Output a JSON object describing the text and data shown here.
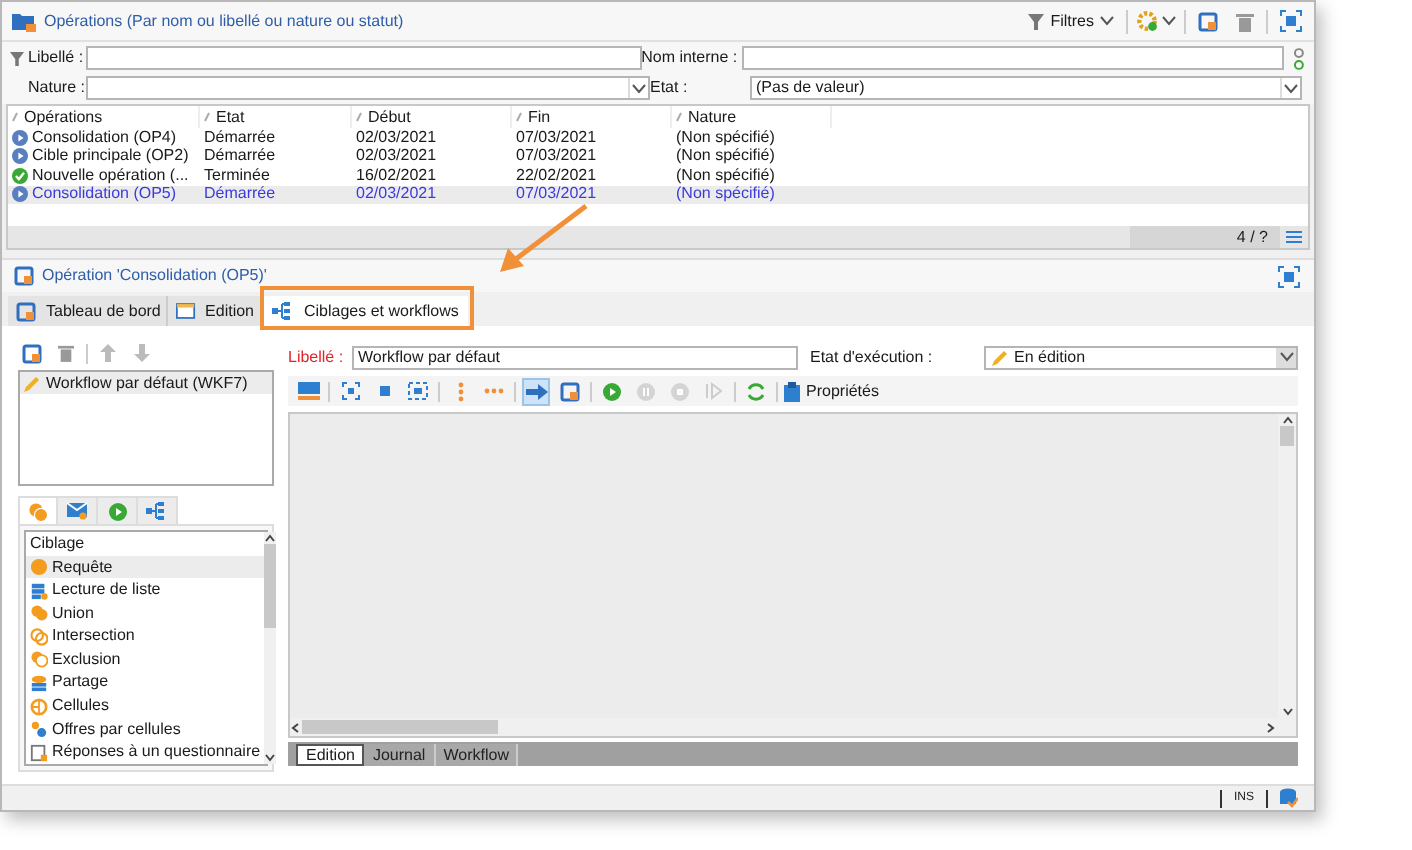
{
  "header": {
    "title": "Opérations (Par nom ou libellé ou nature ou statut)",
    "filters_label": "Filtres"
  },
  "filters": [
    {
      "label": "Libellé :",
      "kind": "text"
    },
    {
      "label": "Nom interne :",
      "kind": "text"
    },
    {
      "label": "Nature :",
      "kind": "select"
    },
    {
      "label": "Etat :",
      "kind": "select",
      "value": "(Pas de valeur)"
    }
  ],
  "operations_table": {
    "columns": [
      "Opérations",
      "Etat",
      "Début",
      "Fin",
      "Nature"
    ],
    "rows": [
      {
        "kind": "started",
        "selected": false,
        "cells": [
          "Consolidation (OP4)",
          "Démarrée",
          "02/03/2021",
          "07/03/2021",
          "(Non spécifié)"
        ]
      },
      {
        "kind": "started",
        "selected": false,
        "cells": [
          "Cible principale (OP2)",
          "Démarrée",
          "02/03/2021",
          "07/03/2021",
          "(Non spécifié)"
        ]
      },
      {
        "kind": "finished",
        "selected": false,
        "cells": [
          "Nouvelle opération (...",
          "Terminée",
          "16/02/2021",
          "22/02/2021",
          "(Non spécifié)"
        ]
      },
      {
        "kind": "started",
        "selected": true,
        "cells": [
          "Consolidation (OP5)",
          "Démarrée",
          "02/03/2021",
          "07/03/2021",
          "(Non spécifié)"
        ]
      }
    ],
    "count": "4 / ?"
  },
  "detail": {
    "title": "Opération 'Consolidation (OP5)'",
    "tabs": [
      {
        "label": "Tableau de bord",
        "kind": "dashboard",
        "selected": false
      },
      {
        "label": "Edition",
        "kind": "edit",
        "selected": false
      },
      {
        "label": "Ciblages et workflows",
        "kind": "workflow",
        "selected": true
      }
    ],
    "workflows": [
      {
        "label": "Workflow par défaut (WKF7)",
        "selected": true
      }
    ],
    "palette_tabs": [
      {
        "kind": "targeting",
        "selected": true
      },
      {
        "kind": "flow",
        "selected": false
      },
      {
        "kind": "actions",
        "selected": false
      },
      {
        "kind": "events",
        "selected": false
      }
    ],
    "palette": {
      "heading": "Ciblage",
      "items": [
        {
          "label": "Requête",
          "kind": "query",
          "selected": true
        },
        {
          "label": "Lecture de liste",
          "kind": "list",
          "selected": false
        },
        {
          "label": "Union",
          "kind": "union",
          "selected": false
        },
        {
          "label": "Intersection",
          "kind": "intersection",
          "selected": false
        },
        {
          "label": "Exclusion",
          "kind": "exclusion",
          "selected": false
        },
        {
          "label": "Partage",
          "kind": "split",
          "selected": false
        },
        {
          "label": "Cellules",
          "kind": "cells",
          "selected": false
        },
        {
          "label": "Offres par cellules",
          "kind": "offers",
          "selected": false
        },
        {
          "label": "Réponses à un questionnaire",
          "kind": "survey",
          "selected": false
        }
      ]
    },
    "workflow_label": {
      "label": "Libellé :",
      "value": "Workflow par défaut"
    },
    "execution_state": {
      "label": "Etat d'exécution :",
      "value": "En édition"
    },
    "properties_label": "Propriétés",
    "canvas_tabs": [
      {
        "label": "Edition",
        "selected": true
      },
      {
        "label": "Journal",
        "selected": false
      },
      {
        "label": "Workflow",
        "selected": false
      }
    ]
  },
  "status_bar": {
    "mode": "INS"
  }
}
